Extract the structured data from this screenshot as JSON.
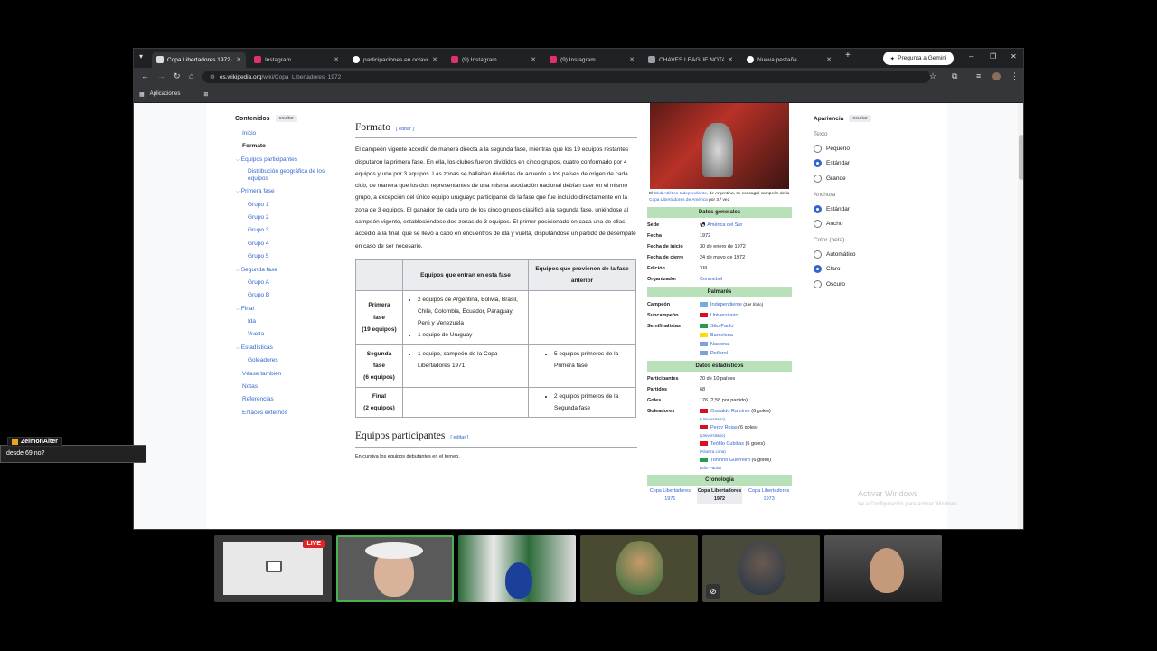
{
  "browser": {
    "tabs": [
      {
        "title": "Copa Libertadores 1972 -",
        "fav": "#ddd",
        "active": true
      },
      {
        "title": "Instagram",
        "fav": "#e1306c"
      },
      {
        "title": "participaciones en octavos",
        "fav": "#fff"
      },
      {
        "title": "(9) Instagram",
        "fav": "#e1306c"
      },
      {
        "title": "(9) Instagram",
        "fav": "#e1306c"
      },
      {
        "title": "CHAVES LEAGUE NOTAS |",
        "fav": "#9aa0a6"
      },
      {
        "title": "Nueva pestaña",
        "fav": "#fff"
      }
    ],
    "gemini_label": "Pregunta a Gemini",
    "url_domain": "es.wikipedia.org",
    "url_path": "/wiki/Copa_Libertadores_1972",
    "bookmarks_label": "Aplicaciones"
  },
  "toc": {
    "title": "Contenidos",
    "hide": "ocultar",
    "items": [
      {
        "label": "Inicio",
        "level": 1
      },
      {
        "label": "Formato",
        "level": 1,
        "current": true
      },
      {
        "label": "Equipos participantes",
        "level": 1,
        "chevron": true
      },
      {
        "label": "Distribución geográfica de los equipos",
        "level": 2
      },
      {
        "label": "Primera fase",
        "level": 1,
        "chevron": true
      },
      {
        "label": "Grupo 1",
        "level": 2
      },
      {
        "label": "Grupo 2",
        "level": 2
      },
      {
        "label": "Grupo 3",
        "level": 2
      },
      {
        "label": "Grupo 4",
        "level": 2
      },
      {
        "label": "Grupo 5",
        "level": 2
      },
      {
        "label": "Segunda fase",
        "level": 1,
        "chevron": true
      },
      {
        "label": "Grupo A",
        "level": 2
      },
      {
        "label": "Grupo B",
        "level": 2
      },
      {
        "label": "Final",
        "level": 1,
        "chevron": true
      },
      {
        "label": "Ida",
        "level": 2
      },
      {
        "label": "Vuelta",
        "level": 2
      },
      {
        "label": "Estadísticas",
        "level": 1,
        "chevron": true
      },
      {
        "label": "Goleadores",
        "level": 2
      },
      {
        "label": "Véase también",
        "level": 1
      },
      {
        "label": "Notas",
        "level": 1
      },
      {
        "label": "Referencias",
        "level": 1
      },
      {
        "label": "Enlaces externos",
        "level": 1
      }
    ]
  },
  "article": {
    "heading": "Formato",
    "edit": "editar",
    "paragraph": "El campeón vigente accedió de manera directa a la segunda fase, mientras que los 19 equipos restantes disputaron la primera fase. En ella, los clubes fueron divididos en cinco grupos, cuatro conformado por 4 equipos y uno por 3 equipos. Las zonas se hallaban divididas de acuerdo a los países de origen de cada club, de manera que los dos representantes de una misma asociación nacional debían caer en el mismo grupo, a excepción del único equipo uruguayo participante de la fase que fue incluido directamente en la zona de 3 equipos. El ganador de cada uno de los cinco grupos clasificó a la segunda fase, uniéndose al campeón vigente, estableciéndose dos zonas de 3 equipos. El primer posicionado en cada una de ellas accedió a la final, que se llevó a cabo en encuentros de ida y vuelta, disputándose un partido de desempate en caso de ser necesario.",
    "table": {
      "headers": [
        "",
        "Equipos que entran en esta fase",
        "Equipos que provienen de la fase anterior"
      ],
      "rows": [
        {
          "phase": "Primera fase",
          "count": "(19 equipos)",
          "enter": [
            "2 equipos de Argentina, Bolivia, Brasil, Chile, Colombia, Ecuador, Paraguay, Perú y Venezuela",
            "1 equipo de Uruguay"
          ],
          "prev": ""
        },
        {
          "phase": "Segunda fase",
          "count": "(6 equipos)",
          "enter": [
            "1 equipo, campeón de la Copa Libertadores 1971"
          ],
          "prev": "5 equipos primeros de la Primera fase"
        },
        {
          "phase": "Final",
          "count": "(2 equipos)",
          "enter": [],
          "prev": "2 equipos primeros de la Segunda fase"
        }
      ]
    },
    "heading2": "Equipos participantes",
    "note": "En cursiva los equipos debutantes en el torneo."
  },
  "infobox": {
    "caption_lead": "El ",
    "caption_club": "Club Atlético Independiente",
    "caption_mid": ", de Argentina, se consagró campeón de la ",
    "caption_cup": "Copa Libertadores de América",
    "caption_tail": " por 3.ª vez",
    "sec_general": "Datos generales",
    "sede_k": "Sede",
    "sede_v": "América del Sur",
    "fecha_k": "Fecha",
    "fecha_v": "1972",
    "inicio_k": "Fecha de inicio",
    "inicio_v": "30 de enero de 1972",
    "cierre_k": "Fecha de cierre",
    "cierre_v": "24 de mayo de 1972",
    "edicion_k": "Edición",
    "edicion_v": "XIII",
    "org_k": "Organizador",
    "org_v": "Conmebol",
    "sec_palmares": "Palmarés",
    "campeon_k": "Campeón",
    "campeon_v": "Independiente",
    "campeon_n": "(3.er título)",
    "sub_k": "Subcampeón",
    "sub_v": "Universitario",
    "semi_k": "Semifinalistas",
    "semis": [
      {
        "name": "São Paulo",
        "flag": "#229e45"
      },
      {
        "name": "Barcelona",
        "flag": "#ffdd00"
      },
      {
        "name": "Nacional",
        "flag": "#7ba3d8"
      },
      {
        "name": "Peñarol",
        "flag": "#7ba3d8"
      }
    ],
    "sec_stats": "Datos estadísticos",
    "part_k": "Participantes",
    "part_v": "20 de 10 países",
    "partidos_k": "Partidos",
    "partidos_v": "68",
    "goles_k": "Goles",
    "goles_v": "176 (2,58 por partido)",
    "goleadores_k": "Goleadores",
    "scorers": [
      {
        "name": "Oswaldo Ramírez",
        "goals": " (6 goles)",
        "club": "(Universitario)",
        "flag": "#d91023"
      },
      {
        "name": "Percy Rojas",
        "goals": " (6 goles)",
        "club": "(Universitario)",
        "flag": "#d91023"
      },
      {
        "name": "Teófilo Cubillas",
        "goals": " (6 goles)",
        "club": "(Alianza Lima)",
        "flag": "#d91023"
      },
      {
        "name": "Toninho Guerreiro",
        "goals": " (6 goles)",
        "club": "(São Paulo)",
        "flag": "#229e45"
      }
    ],
    "sec_crono": "Cronología",
    "crono": [
      "Copa Libertadores 1971",
      "Copa Libertadores 1972",
      "Copa Libertadores 1973"
    ]
  },
  "appearance": {
    "title": "Apariencia",
    "hide": "ocultar",
    "text_label": "Texto",
    "text_opts": [
      "Pequeño",
      "Estándar",
      "Grande"
    ],
    "width_label": "Anchura",
    "width_opts": [
      "Estándar",
      "Ancho"
    ],
    "color_label": "Color (beta)",
    "color_opts": [
      "Automático",
      "Claro",
      "Oscuro"
    ]
  },
  "watermark": {
    "title": "Activar Windows",
    "sub": "Ve a Configuración para activar Windows."
  },
  "chat": {
    "user": "ZelmonAlter",
    "message": "desde 69 no?"
  },
  "call": {
    "live": "LIVE"
  }
}
